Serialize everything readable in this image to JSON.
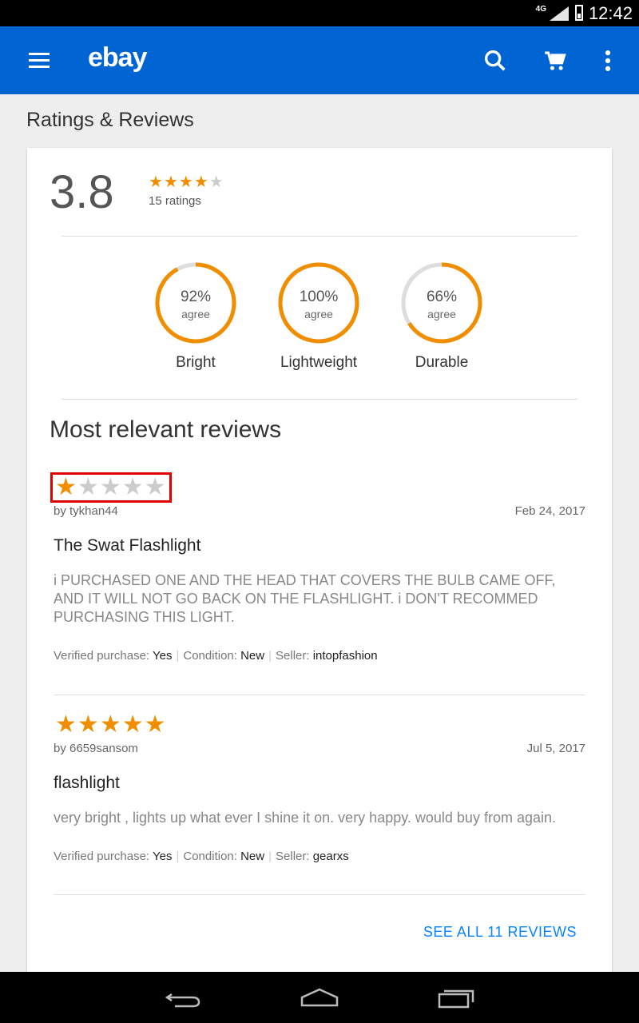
{
  "status_bar": {
    "network": "4G",
    "time": "12:42"
  },
  "app_bar": {
    "logo": "ebay",
    "icons": [
      "menu-icon",
      "search-icon",
      "cart-icon",
      "more-vert-icon"
    ]
  },
  "page": {
    "title": "Ratings & Reviews"
  },
  "summary": {
    "average": "3.8",
    "stars": 4,
    "ratings_count": "15 ratings"
  },
  "metrics": [
    {
      "percent": "92%",
      "agree": "agree",
      "name": "Bright",
      "value": 0.92
    },
    {
      "percent": "100%",
      "agree": "agree",
      "name": "Lightweight",
      "value": 1.0
    },
    {
      "percent": "66%",
      "agree": "agree",
      "name": "Durable",
      "value": 0.66
    }
  ],
  "reviews_section": {
    "title": "Most relevant reviews"
  },
  "reviews": [
    {
      "stars": 1,
      "author": "by tykhan44",
      "date": "Feb 24, 2017",
      "title": "The Swat Flashlight",
      "body": "i PURCHASED ONE AND THE HEAD THAT COVERS THE BULB CAME OFF, AND IT WILL NOT GO BACK ON THE FLASHLIGHT. i DON'T RECOMMED PURCHASING THIS LIGHT.",
      "verified_label": "Verified purchase:",
      "verified": "Yes",
      "condition_label": "Condition:",
      "condition": "New",
      "seller_label": "Seller:",
      "seller": "intopfashion"
    },
    {
      "stars": 5,
      "author": "by 6659sansom",
      "date": "Jul 5, 2017",
      "title": "flashlight",
      "body": "very bright , lights up what ever I shine it on. very happy. would buy from again.",
      "verified_label": "Verified purchase:",
      "verified": "Yes",
      "condition_label": "Condition:",
      "condition": "New",
      "seller_label": "Seller:",
      "seller": "gearxs"
    }
  ],
  "see_all": "SEE ALL 11 REVIEWS",
  "colors": {
    "brand": "#0064d2",
    "star": "#f18e00",
    "link": "#0a84ff",
    "highlight": "#e00000"
  }
}
